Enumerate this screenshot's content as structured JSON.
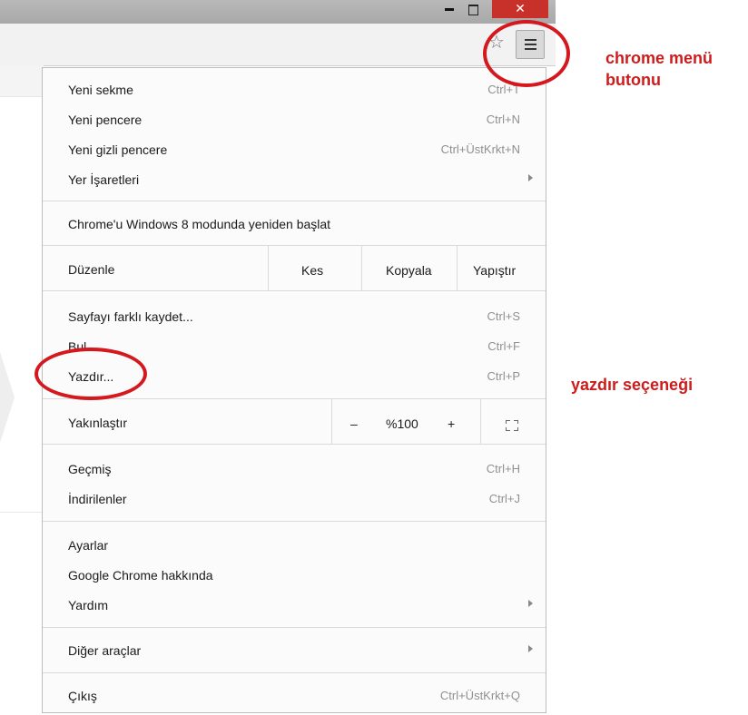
{
  "window": {
    "close_glyph": "✕"
  },
  "toolbar": {
    "star_glyph": "☆"
  },
  "menu": {
    "items": [
      {
        "label": "Yeni sekme",
        "shortcut": "Ctrl+T"
      },
      {
        "label": "Yeni pencere",
        "shortcut": "Ctrl+N"
      },
      {
        "label": "Yeni gizli pencere",
        "shortcut": "Ctrl+ÜstKrkt+N"
      },
      {
        "label": "Yer İşaretleri",
        "shortcut": ""
      },
      {
        "label": "Chrome'u Windows 8 modunda yeniden başlat",
        "shortcut": ""
      },
      {
        "label": "Sayfayı farklı kaydet...",
        "shortcut": "Ctrl+S"
      },
      {
        "label": "Bul",
        "shortcut": "Ctrl+F"
      },
      {
        "label": "Yazdır...",
        "shortcut": "Ctrl+P"
      },
      {
        "label": "Geçmiş",
        "shortcut": "Ctrl+H"
      },
      {
        "label": "İndirilenler",
        "shortcut": "Ctrl+J"
      },
      {
        "label": "Ayarlar",
        "shortcut": ""
      },
      {
        "label": "Google Chrome hakkında",
        "shortcut": ""
      },
      {
        "label": "Yardım",
        "shortcut": ""
      },
      {
        "label": "Diğer araçlar",
        "shortcut": ""
      },
      {
        "label": "Çıkış",
        "shortcut": "Ctrl+ÜstKrkt+Q"
      }
    ],
    "edit": {
      "label": "Düzenle",
      "cut": "Kes",
      "copy": "Kopyala",
      "paste": "Yapıştır"
    },
    "zoom": {
      "label": "Yakınlaştır",
      "minus": "–",
      "value": "%100",
      "plus": "+"
    }
  },
  "annotations": {
    "menu_button_line1": "chrome menü",
    "menu_button_line2": "butonu",
    "print_option": "yazdır seçeneği",
    "highlight_color": "#d4181e"
  }
}
